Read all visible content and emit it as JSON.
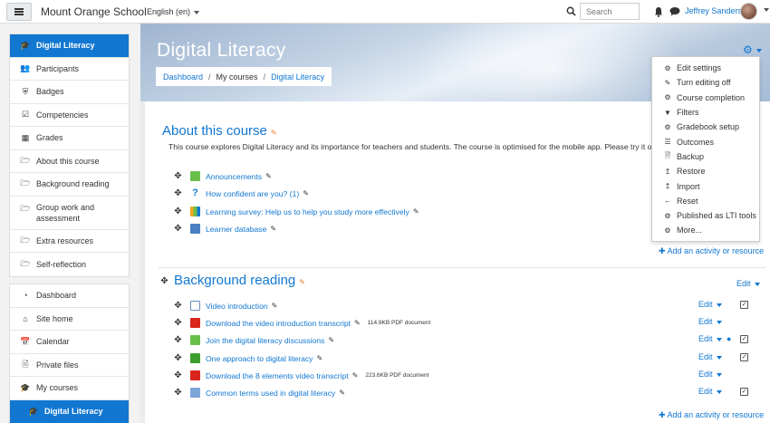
{
  "navbar": {
    "site_name": "Mount Orange School",
    "language": "English (en)",
    "search_placeholder": "Search",
    "user_name": "Jeffrey Sanders"
  },
  "sidebar": {
    "course_items": [
      {
        "label": "Digital Literacy",
        "icon": "graduation-cap-icon",
        "active": true
      },
      {
        "label": "Participants",
        "icon": "users-icon"
      },
      {
        "label": "Badges",
        "icon": "shield-icon"
      },
      {
        "label": "Competencies",
        "icon": "checkbox-icon"
      },
      {
        "label": "Grades",
        "icon": "table-icon"
      },
      {
        "label": "About this course",
        "icon": "folder-icon"
      },
      {
        "label": "Background reading",
        "icon": "folder-icon"
      },
      {
        "label": "Group work and assessment",
        "icon": "folder-icon"
      },
      {
        "label": "Extra resources",
        "icon": "folder-icon"
      },
      {
        "label": "Self-reflection",
        "icon": "folder-icon"
      }
    ],
    "site_items": [
      {
        "label": "Dashboard",
        "icon": "dashboard-icon"
      },
      {
        "label": "Site home",
        "icon": "home-icon"
      },
      {
        "label": "Calendar",
        "icon": "calendar-icon"
      },
      {
        "label": "Private files",
        "icon": "file-icon"
      },
      {
        "label": "My courses",
        "icon": "graduation-cap-icon"
      },
      {
        "label": "Digital Literacy",
        "icon": "graduation-cap-icon",
        "active": true
      }
    ]
  },
  "header": {
    "course_title": "Digital Literacy",
    "breadcrumb": [
      "Dashboard",
      "My courses",
      "Digital Literacy"
    ]
  },
  "admin_menu": [
    {
      "label": "Edit settings",
      "icon": "gear-icon"
    },
    {
      "label": "Turn editing off",
      "icon": "pencil-icon"
    },
    {
      "label": "Course completion",
      "icon": "gear-icon"
    },
    {
      "label": "Filters",
      "icon": "filter-icon"
    },
    {
      "label": "Gradebook setup",
      "icon": "gear-icon"
    },
    {
      "label": "Outcomes",
      "icon": "list-icon"
    },
    {
      "label": "Backup",
      "icon": "file-icon"
    },
    {
      "label": "Restore",
      "icon": "upload-icon"
    },
    {
      "label": "Import",
      "icon": "upload-icon"
    },
    {
      "label": "Reset",
      "icon": "arrow-left-icon"
    },
    {
      "label": "Published as LTI tools",
      "icon": "gear-icon"
    },
    {
      "label": "More...",
      "icon": "gear-icon"
    }
  ],
  "section_about": {
    "title": "About this course",
    "summary": "This course explores Digital Literacy and its importance for teachers and students. The course is optimised for the mobile app. Please try it o",
    "activities": [
      {
        "label": "Announcements",
        "icon": "forum-icon"
      },
      {
        "label": "How confident are you? (1)",
        "icon": "question-icon"
      },
      {
        "label": "Learning survey: Help us to help you study more effectively",
        "icon": "survey-icon"
      },
      {
        "label": "Learner database",
        "icon": "database-icon"
      }
    ],
    "add_activity": "Add an activity or resource"
  },
  "section_background": {
    "title": "Background reading",
    "edit_label": "Edit",
    "activities": [
      {
        "label": "Video introduction",
        "icon": "page-icon",
        "fileinfo": "",
        "edit": "Edit"
      },
      {
        "label": "Download the video introduction transcript",
        "icon": "pdf-icon",
        "fileinfo": "114.9KB PDF document",
        "edit": "Edit"
      },
      {
        "label": "Join the digital literacy discussions",
        "icon": "forum-icon",
        "fileinfo": "",
        "edit": "Edit"
      },
      {
        "label": "One approach to digital literacy",
        "icon": "book-icon",
        "fileinfo": "",
        "edit": "Edit"
      },
      {
        "label": "Download the 8 elements video transcript",
        "icon": "pdf-icon",
        "fileinfo": "223.6KB PDF document",
        "edit": "Edit"
      },
      {
        "label": "Common terms used in digital literacy",
        "icon": "glossary-icon",
        "fileinfo": "",
        "edit": "Edit"
      }
    ],
    "add_activity": "Add an activity or resource"
  },
  "colors": {
    "accent": "#1177d1",
    "edit_pencil": "#f0761e"
  }
}
